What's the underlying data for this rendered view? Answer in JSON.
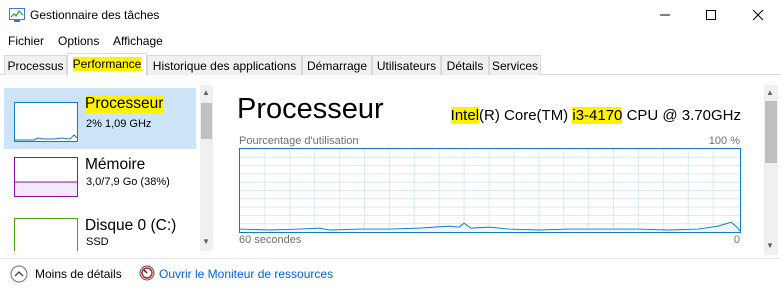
{
  "window": {
    "title": "Gestionnaire des tâches"
  },
  "menu": {
    "items": [
      "Fichier",
      "Options",
      "Affichage"
    ]
  },
  "tabs": [
    "Processus",
    "Performance",
    "Historique des applications",
    "Démarrage",
    "Utilisateurs",
    "Détails",
    "Services"
  ],
  "active_tab": "Performance",
  "sidebar": {
    "items": [
      {
        "title": "Processeur",
        "subtitle": "2%  1,09 GHz",
        "color": "#117dbb",
        "selected": true
      },
      {
        "title": "Mémoire",
        "subtitle": "3,0/7,9 Go (38%)",
        "color": "#8b12ae",
        "selected": false
      },
      {
        "title": "Disque 0 (C:)",
        "subtitle": "SSD",
        "color": "#4da60c",
        "selected": false
      }
    ]
  },
  "main": {
    "title": "Processeur",
    "cpu_name": {
      "brand": "Intel",
      "mid": "(R) Core(TM) ",
      "model": "i3-4170",
      "tail": " CPU @ 3.70GHz"
    },
    "graph": {
      "label": "Pourcentage d'utilisation",
      "max_label": "100 %",
      "x_label": "60 secondes",
      "min_label": "0",
      "color": "#117dbb",
      "grid_color": "#d9eaf4"
    }
  },
  "footer": {
    "less_details": "Moins de détails",
    "resource_monitor": "Ouvrir le Moniteur de ressources"
  },
  "highlight_color": "#fff200"
}
